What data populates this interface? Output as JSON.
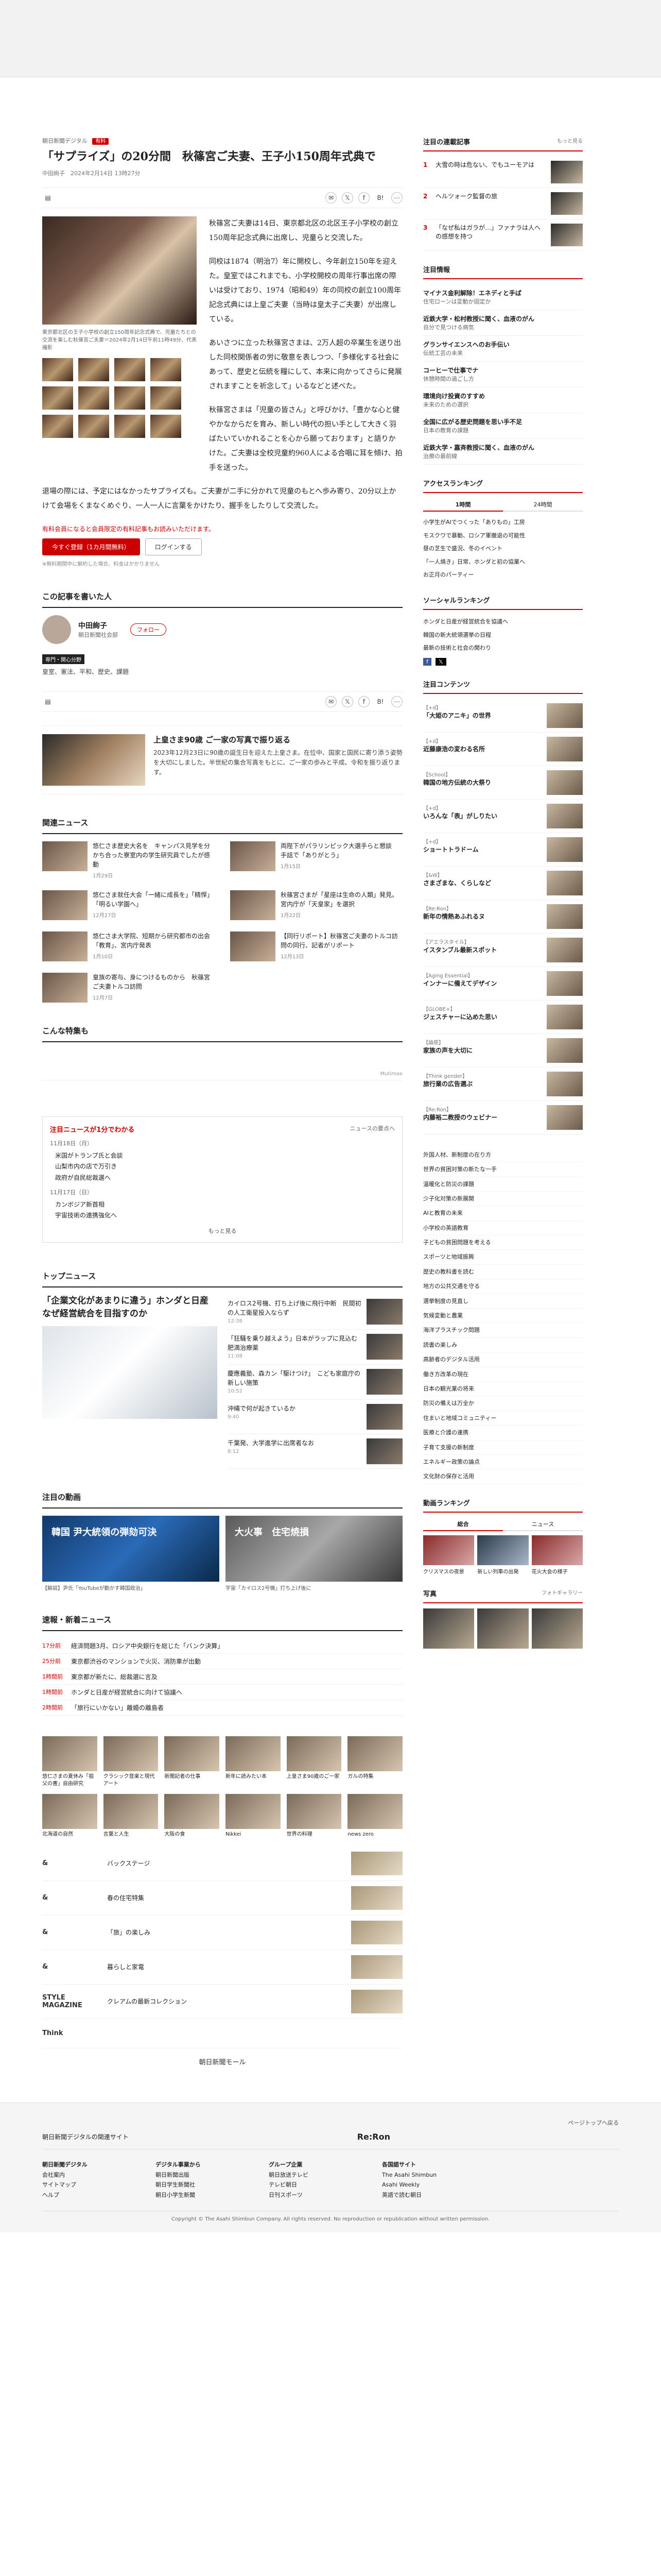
{
  "article": {
    "crumb": "朝日新聞デジタル",
    "tag": "有料",
    "title": "「サプライズ」の20分間　秋篠宮ご夫妻、王子小150周年式典で",
    "byline": "中田絢子　2024年2月14日 13時27分",
    "caption": "東京都北区の王子小学校の創立150周年記念式典で、児童たちとの交流を楽しむ秋篠宮ご夫妻＝2024年2月14日午前11時49分、代表撮影",
    "p1": "秋篠宮ご夫妻は14日、東京都北区の北区王子小学校の創立150周年記念式典に出席し、児童らと交流した。",
    "p2": "同校は1874（明治7）年に開校し、今年創立150年を迎えた。皇室ではこれまでも、小学校開校の周年行事出席の際いは受けており、1974（昭和49）年の同校の創立100周年記念式典には上皇ご夫妻（当時は皇太子ご夫妻）が出席している。",
    "p3": "あいさつに立った秋篠宮さまは、2万人超の卒業生を送り出した同校関係者の労に敬意を表しつつ、「多様化する社会にあって、歴史と伝統を糧にして、本来に向かってさらに発展されますことを祈念して」いるなどと述べた。",
    "p4": "秋篠宮さまは「児童の皆さん」と呼びかけ、「豊かな心と健やかなからだを育み、新しい時代の担い手として大きく羽ばたいていかれることを心から願っております」と語りかけた。ご夫妻は全校児童約960人による合唱に耳を傾け、拍手を送った。",
    "p5": "退場の際には、予定にはなかったサプライズも。ご夫妻が二手に分かれて児童のもとへ歩み寄り、20分以上かけて会場をくまなくめぐり、一人一人に言葉をかけたり、握手をしたりして交流した。",
    "paywall_note": "有料会員になると会員限定の有料記事もお読みいただけます。",
    "btn_join": "今すぐ登録（1カ月間無料）",
    "btn_login": "ログインする",
    "small": "※無料期間中に解約した場合、料金はかかりません"
  },
  "author": {
    "heading": "この記事を書いた人",
    "name": "中田絢子",
    "org": "朝日新聞社会部",
    "follow": "フォロー",
    "tag": "専門・関心分野",
    "kw": "皇室、憲法、平和、歴史、課題"
  },
  "feature": {
    "title": "上皇さま90歳 ご一家の写真で振り返る",
    "desc": "2023年12月23日に90歳の誕生日を迎えた上皇さま。在位中、国家と国民に寄り添う姿勢を大切にしました。半世紀の集合写真をもとに、ご一家の歩みと平成、令和を振り返ります。"
  },
  "related": {
    "heading": "関連ニュース",
    "items": [
      {
        "t": "悠仁さま歴史大名を　キャンパス見学を分かち合った寮室内の学生研究員でしたが感動",
        "d": "1月29日"
      },
      {
        "t": "両陛下がパラリンピック大選手らと懇談　手話で「ありがとう」",
        "d": "1月15日"
      },
      {
        "t": "悠仁さま就任大会「一緒に成長を」「精悍」「明るい学園へ」",
        "d": "12月27日"
      },
      {
        "t": "秋篠宮さまが「星座は生命の人類」発見。宮内庁が「天皇家」を選択",
        "d": "1月22日"
      },
      {
        "t": "悠仁さま大学院、短期から研究都市の出会「教育」、宮内庁発表",
        "d": "1月10日"
      },
      {
        "t": "【同行リポート】秋篠宮ご夫妻のトルコ訪問の同行、記者がリポート",
        "d": "12月13日"
      },
      {
        "t": "皇族の寄与、身につけるものから　秋篠宮ご夫妻トルコ訪問",
        "d": "12月7日"
      },
      {
        "t": "",
        "d": ""
      }
    ]
  },
  "ad_heading": "こんな特集も",
  "ad_label": "Mutimax",
  "headlines": {
    "heading": "注目ニュースが1分でわかる",
    "link": "ニュースの要点へ",
    "date1": "11月18日（月）",
    "items1": [
      "米国がトランプ氏と会談",
      "山梨市内の店で万引き",
      "政府が自民総裁選へ"
    ],
    "date2": "11月17日（日）",
    "items2": [
      "カンボジア新首相",
      "宇宙技術の連携強化へ"
    ],
    "more": "もっと見る"
  },
  "topnews": {
    "heading": "トップニュース",
    "lead": "「企業文化があまりに違う」ホンダと日産　なぜ経営統合を目指すのか",
    "items": [
      {
        "t": "カイロス2号機、打ち上げ後に飛行中断　民間初の人工衛星投入ならず",
        "tm": "12:38"
      },
      {
        "t": "「狂騒を乗り越えよう」日本がラップに見込む肥満治療薬",
        "tm": "11:08"
      },
      {
        "t": "慶應義塾、森カン「駆けつけ」　こども家庭庁の新しい施策",
        "tm": "10:52"
      },
      {
        "t": "沖縄で何が起きているか",
        "tm": "9:40"
      },
      {
        "t": "千葉発、大学進学に出席者なお",
        "tm": "8:12"
      }
    ]
  },
  "video": {
    "heading": "注目の動画",
    "v1": "韓国 尹大統領の弾劾可決",
    "v1cap": "【解説】尹氏「YouTubeが動かす韓国政治」",
    "v2": "大火事　住宅焼損",
    "v2cap": "宇宙「カイロス2号機」打ち上げ後に"
  },
  "ranking": {
    "heading": "速報・新着ニュース",
    "rows": [
      {
        "n": "17分前",
        "t": "経済問題3月、ロシア中央銀行を総じた「バンク決算」"
      },
      {
        "n": "25分前",
        "t": "東京都渋谷のマンションで火災、消防車が出動"
      },
      {
        "n": "1時間前",
        "t": "東京都が新たに、総裁選に言及"
      },
      {
        "n": "1時間前",
        "t": "ホンダと日産が経営統合に向けて協議へ"
      },
      {
        "n": "2時間前",
        "t": "「旅行にいかない」離婚の離島者"
      }
    ]
  },
  "tiles": [
    "悠仁さまの夏休み「祖父の書」自由研究",
    "クラシック音楽と現代アート",
    "新聞記者の仕事",
    "新年に読みたい本",
    "上皇さま90歳のご一家",
    "ガルの特集",
    "北海道の自然",
    "言葉と人生",
    "大阪の食",
    "Nikkei",
    "世界の料理",
    "news zero"
  ],
  "brands": [
    {
      "lg": "&",
      "t": "バックステージ"
    },
    {
      "lg": "&",
      "t": "春の住宅特集"
    },
    {
      "lg": "&",
      "t": "「旅」の楽しみ"
    },
    {
      "lg": "&",
      "t": "暮らしと家電"
    },
    {
      "lg": "STYLE MAGAZINE",
      "t": "クレアムの最新コレクション"
    },
    {
      "lg": "Think",
      "t": ""
    }
  ],
  "shop": "朝日新聞モール",
  "sidebar": {
    "rank_heading": "注目の連載記事",
    "rank_more": "もっと見る",
    "rank": [
      {
        "n": "1",
        "t": "大雪の時は危ない、でもユーモアは"
      },
      {
        "n": "2",
        "t": "ヘルツォーク監督の旅"
      },
      {
        "n": "3",
        "t": "「なぜ私はガラが…」ファナラは人への感想を持つ"
      }
    ],
    "press_heading": "注目情報",
    "press": [
      {
        "ln": "マイナス金利解除！エネディと手ば",
        "dt": "住宅ローンは変動か固定か"
      },
      {
        "ln": "近鉄大学・松村教授に聞く、血液のがん",
        "dt": "自分で見つける病気"
      },
      {
        "ln": "グランサイエンスへのお手伝い",
        "dt": "伝統工芸の未来"
      },
      {
        "ln": "コーヒーで仕事でナ",
        "dt": "休憩時間の過ごし方"
      },
      {
        "ln": "環境向け投資のすすめ",
        "dt": "未来のための選択"
      },
      {
        "ln": "全国に広がる歴史問題を思い手不足",
        "dt": "日本の教育の課題"
      },
      {
        "ln": "近鉄大学・嘉斉教授に聞く、血液のがん",
        "dt": "治療の最前線"
      }
    ],
    "access_heading": "アクセスランキング",
    "access_tabs": [
      "1時間",
      "24時間"
    ],
    "access": [
      "小学生がAIでつくった「ありもの」工房",
      "モスクワで暴動、ロシア軍撤退の可能性",
      "昼の芝生で盛況、冬のイベント",
      "「一人焼き」日常、ホンダと初の協業へ",
      "お正月のパーティー"
    ],
    "social_heading": "ソーシャルランキング",
    "social": [
      "ホンダと日産が経営統合を協議へ",
      "韓国の新大統領選挙の日程",
      "最新の技術と社会の関わり"
    ],
    "series_heading": "注目コンテンツ",
    "series": [
      {
        "tg": "【+d】",
        "t": "「大姫のアニキ」の世界"
      },
      {
        "tg": "【+d】",
        "t": "近藤康浩の変わる名所"
      },
      {
        "tg": "【School】",
        "t": "韓国の地方伝統の大祭り"
      },
      {
        "tg": "【+d】",
        "t": "いろんな「表」がしりたい"
      },
      {
        "tg": "【+d】",
        "t": "ショートトラドーム"
      },
      {
        "tg": "【&W】",
        "t": "さまざまな、くらしなど"
      },
      {
        "tg": "【Re:Ron】",
        "t": "新年の情熱あふれるヌ"
      },
      {
        "tg": "【アエラスタイル】",
        "t": "イスタンブル最新スポット"
      },
      {
        "tg": "【Aging Essential】",
        "t": "インナーに備えてデザイン"
      },
      {
        "tg": "【GLOBE+】",
        "t": "ジェスチャーに込めた思い"
      },
      {
        "tg": "【論座】",
        "t": "家族の声を大切に"
      },
      {
        "tg": "【Think gender】",
        "t": "旅行業の広告選ぶ"
      },
      {
        "tg": "【Re:Ron】",
        "t": "内藤裕二教授のウェビナー"
      }
    ],
    "plain": [
      "外国人材、新制度の在り方",
      "世界の貧困対策の新たな一手",
      "温暖化と防災の課題",
      "少子化対策の新展開",
      "AIと教育の未来",
      "小学校の英語教育",
      "子どもの貧困問題を考える",
      "スポーツと地域振興",
      "歴史の教科書を読む",
      "地方の公共交通を守る",
      "選挙制度の見直し",
      "気候変動と農業",
      "海洋プラスチック問題",
      "読書の楽しみ",
      "高齢者のデジタル活用",
      "働き方改革の現在",
      "日本の観光業の将来",
      "防災の備えは万全か",
      "住まいと地域コミュニティー",
      "医療と介護の連携",
      "子育て支援の新制度",
      "エネルギー政策の論点",
      "文化財の保存と活用"
    ],
    "vid_heading": "動画ランキング",
    "vid_tabs": [
      "総合",
      "ニュース"
    ],
    "vids": [
      "クリスマスの夜景",
      "新しい列車の出発",
      "花火大会の様子"
    ],
    "photo_heading": "写真",
    "photo_more": "フォトギャラリー"
  },
  "footer": {
    "pagetop": "ページトップへ戻る",
    "brand": "朝日新聞デジタルの関連サイト",
    "reron": "Re:Ron",
    "cols": [
      [
        "朝日新聞デジタル",
        "会社案内",
        "サイトマップ",
        "ヘルプ"
      ],
      [
        "デジタル事業から",
        "朝日新聞出版",
        "朝日学生新聞社",
        "朝日小学生新聞"
      ],
      [
        "グループ企業",
        "朝日放送テレビ",
        "テレビ朝日",
        "日刊スポーツ"
      ],
      [
        "各国語サイト",
        "The Asahi Shimbun",
        "Asahi Weekly",
        "英語で読む朝日"
      ]
    ],
    "copyright": "Copyright © The Asahi Shimbun Company. All rights reserved. No reproduction or republication without written permission."
  }
}
